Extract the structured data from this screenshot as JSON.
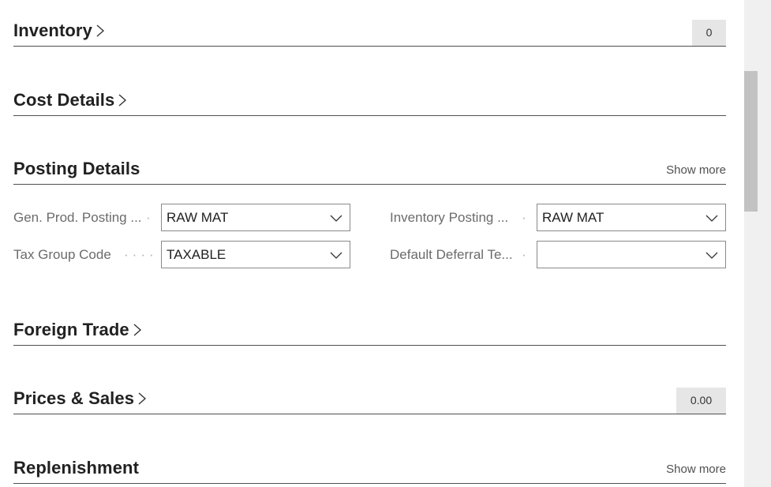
{
  "sections": {
    "inventory": {
      "title": "Inventory",
      "badge": "0"
    },
    "cost_details": {
      "title": "Cost Details"
    },
    "posting_details": {
      "title": "Posting Details",
      "show_more": "Show more",
      "fields": {
        "gen_prod_posting": {
          "label": "Gen. Prod. Posting ...",
          "value": "RAW MAT"
        },
        "inventory_posting": {
          "label": "Inventory Posting ...",
          "value": "RAW MAT"
        },
        "tax_group_code": {
          "label": "Tax Group Code",
          "value": "TAXABLE"
        },
        "default_deferral": {
          "label": "Default Deferral Te...",
          "value": ""
        }
      }
    },
    "foreign_trade": {
      "title": "Foreign Trade"
    },
    "prices_sales": {
      "title": "Prices & Sales",
      "badge": "0.00"
    },
    "replenishment": {
      "title": "Replenishment",
      "show_more": "Show more"
    }
  },
  "icons": {
    "expand": "chevron-right-icon",
    "dropdown": "chevron-down-icon"
  }
}
